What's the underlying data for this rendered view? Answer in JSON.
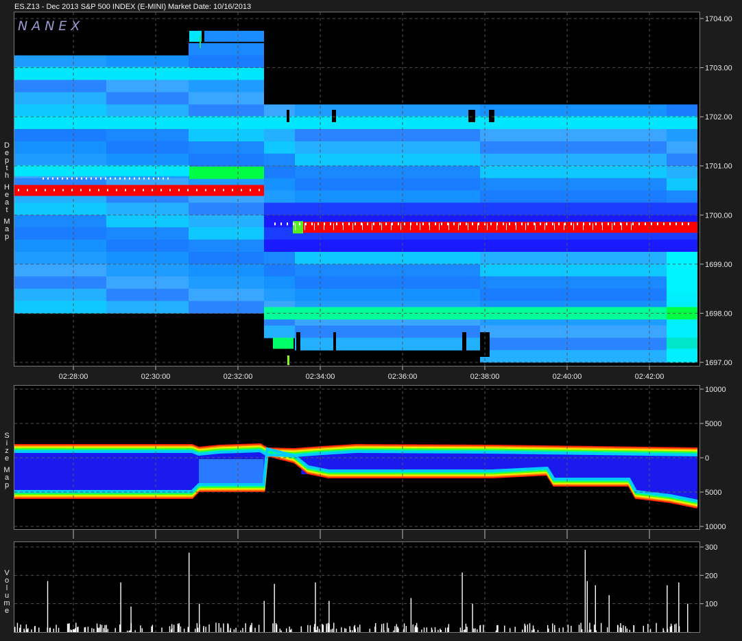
{
  "header": {
    "symbol": "ES.Z13 - Dec 2013 S&P 500 INDEX (E-MINI)",
    "market_date": "Market Date: 10/16/2013"
  },
  "logo": "NANEX",
  "side_labels": {
    "depth": "Depth",
    "heat": "Heat",
    "map": "Map",
    "size": "Size",
    "size_map": "Map",
    "volume": "Volume"
  },
  "colors": {
    "background": "#1c1c1c",
    "panel": "#000000",
    "grid": "#555555",
    "bid_red": "#ff0000",
    "cyan": "#00e6ff",
    "blue": "#1a6aff",
    "deep_blue": "#1a1aff",
    "green": "#00ff44"
  },
  "chart_data": [
    {
      "type": "heatmap",
      "panel": "depth-heat-map",
      "x_ticks": [
        "02:28:00",
        "02:30:00",
        "02:32:00",
        "02:34:00",
        "02:36:00",
        "02:38:00",
        "02:40:00",
        "02:42:00"
      ],
      "y_ticks": [
        "1704.00",
        "1703.00",
        "1702.00",
        "1701.00",
        "1700.00",
        "1699.00",
        "1698.00",
        "1697.00"
      ],
      "ylim": [
        1697.0,
        1704.0
      ],
      "red_level_before": 1700.5,
      "red_level_after": 1699.75,
      "grid": true
    },
    {
      "type": "area",
      "panel": "size-map",
      "y_ticks": [
        "10000",
        "5000",
        "0",
        "5000",
        "10000"
      ],
      "ylim": [
        -10000,
        10000
      ],
      "upper_band": [
        {
          "t": 0,
          "v": 1800
        },
        {
          "t": 0.26,
          "v": 1800
        },
        {
          "t": 0.27,
          "v": 1400
        },
        {
          "t": 0.3,
          "v": 1700
        },
        {
          "t": 0.36,
          "v": 1900
        },
        {
          "t": 0.37,
          "v": 1300
        },
        {
          "t": 0.41,
          "v": 1200
        },
        {
          "t": 0.45,
          "v": 1500
        },
        {
          "t": 0.5,
          "v": 1800
        },
        {
          "t": 0.7,
          "v": 1700
        },
        {
          "t": 0.85,
          "v": 1500
        },
        {
          "t": 1,
          "v": 1300
        }
      ],
      "lower_band": [
        {
          "t": 0,
          "v": -5800
        },
        {
          "t": 0.26,
          "v": -5800
        },
        {
          "t": 0.27,
          "v": -4800
        },
        {
          "t": 0.365,
          "v": -4800
        },
        {
          "t": 0.37,
          "v": 400
        },
        {
          "t": 0.41,
          "v": -600
        },
        {
          "t": 0.43,
          "v": -2200
        },
        {
          "t": 0.46,
          "v": -2800
        },
        {
          "t": 0.5,
          "v": -2800
        },
        {
          "t": 0.66,
          "v": -2800
        },
        {
          "t": 0.7,
          "v": -2800
        },
        {
          "t": 0.78,
          "v": -2400
        },
        {
          "t": 0.79,
          "v": -4000
        },
        {
          "t": 0.9,
          "v": -4000
        },
        {
          "t": 0.91,
          "v": -5800
        },
        {
          "t": 0.96,
          "v": -6400
        },
        {
          "t": 1,
          "v": -7200
        }
      ],
      "grid": true
    },
    {
      "type": "bar",
      "panel": "volume",
      "y_ticks": [
        "300",
        "200",
        "100"
      ],
      "ylim": [
        0,
        300
      ],
      "x_ticks_count": 8,
      "spikes": [
        {
          "t": 0.048,
          "v": 180
        },
        {
          "t": 0.155,
          "v": 175
        },
        {
          "t": 0.17,
          "v": 90
        },
        {
          "t": 0.255,
          "v": 280
        },
        {
          "t": 0.27,
          "v": 100
        },
        {
          "t": 0.365,
          "v": 110
        },
        {
          "t": 0.38,
          "v": 170
        },
        {
          "t": 0.44,
          "v": 175
        },
        {
          "t": 0.46,
          "v": 110
        },
        {
          "t": 0.58,
          "v": 120
        },
        {
          "t": 0.655,
          "v": 210
        },
        {
          "t": 0.67,
          "v": 100
        },
        {
          "t": 0.835,
          "v": 290
        },
        {
          "t": 0.838,
          "v": 180
        },
        {
          "t": 0.85,
          "v": 165
        },
        {
          "t": 0.87,
          "v": 130
        },
        {
          "t": 0.955,
          "v": 165
        },
        {
          "t": 0.972,
          "v": 175
        },
        {
          "t": 0.985,
          "v": 100
        }
      ],
      "grid": true
    }
  ]
}
